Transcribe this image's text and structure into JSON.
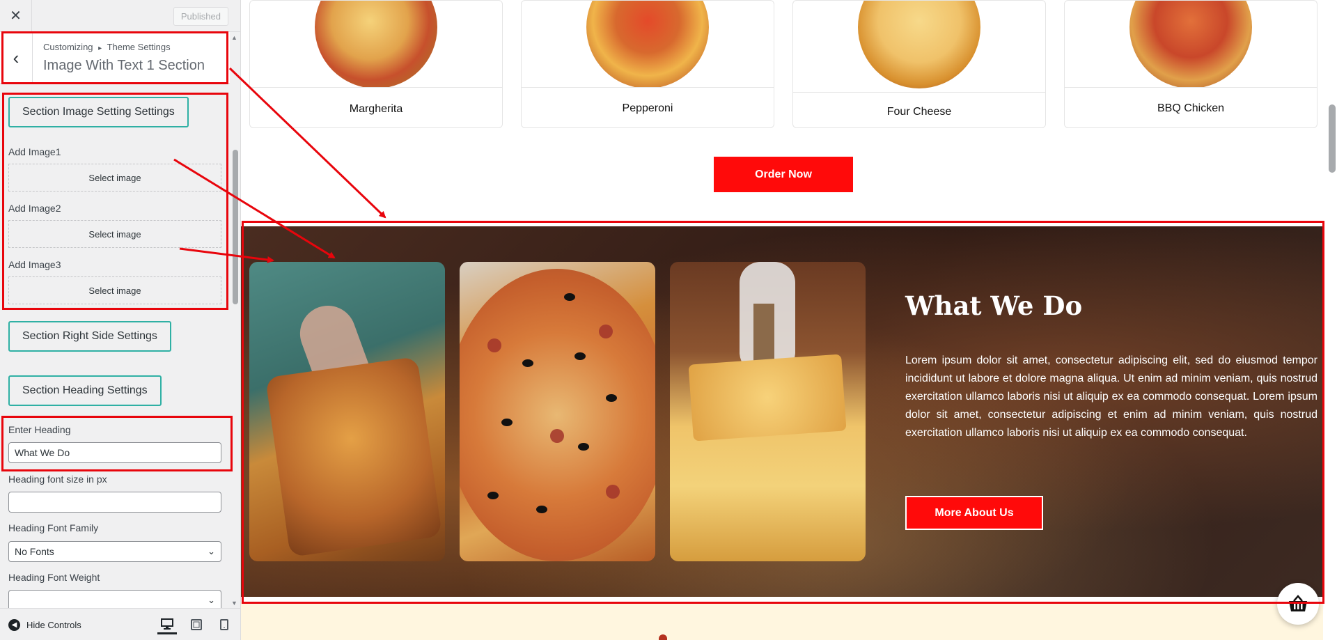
{
  "topbar": {
    "close_icon": "close-icon",
    "published_label": "Published"
  },
  "section_header": {
    "breadcrumb_root": "Customizing",
    "breadcrumb_sep": "▸",
    "breadcrumb_parent": "Theme Settings",
    "title": "Image With Text 1 Section"
  },
  "controls": {
    "image_settings_button": "Section Image Setting Settings",
    "image1_label": "Add Image1",
    "image2_label": "Add Image2",
    "image3_label": "Add Image3",
    "select_image_label": "Select image",
    "right_side_button": "Section Right Side Settings",
    "heading_settings_button": "Section Heading Settings",
    "enter_heading_label": "Enter Heading",
    "enter_heading_value": "What We Do",
    "font_size_label": "Heading font size in px",
    "font_size_value": "",
    "font_family_label": "Heading Font Family",
    "font_family_value": "No Fonts",
    "font_weight_label": "Heading Font Weight",
    "font_weight_value": ""
  },
  "footer": {
    "hide_controls_label": "Hide Controls"
  },
  "preview": {
    "pizzas": [
      {
        "name": "Margherita"
      },
      {
        "name": "Pepperoni"
      },
      {
        "name": "Four Cheese"
      },
      {
        "name": "BBQ Chicken"
      }
    ],
    "order_button": "Order Now",
    "section": {
      "heading": "What We Do",
      "paragraph": "Lorem ipsum dolor sit amet, consectetur adipiscing elit, sed do eiusmod tempor incididunt ut labore et dolore magna aliqua. Ut enim ad minim veniam, quis nostrud exercitation ullamco laboris nisi ut aliquip ex ea commodo consequat. Lorem ipsum dolor sit amet, consectetur adipiscing et enim ad minim veniam, quis nostrud exercitation ullamco laboris nisi ut aliquip ex ea commodo consequat.",
      "button": "More About Us"
    }
  },
  "colors": {
    "accent_red": "#ff0a0a",
    "annotation_red": "#e8050c",
    "teal_border": "#2fb0a4",
    "band": "#fff6df"
  }
}
